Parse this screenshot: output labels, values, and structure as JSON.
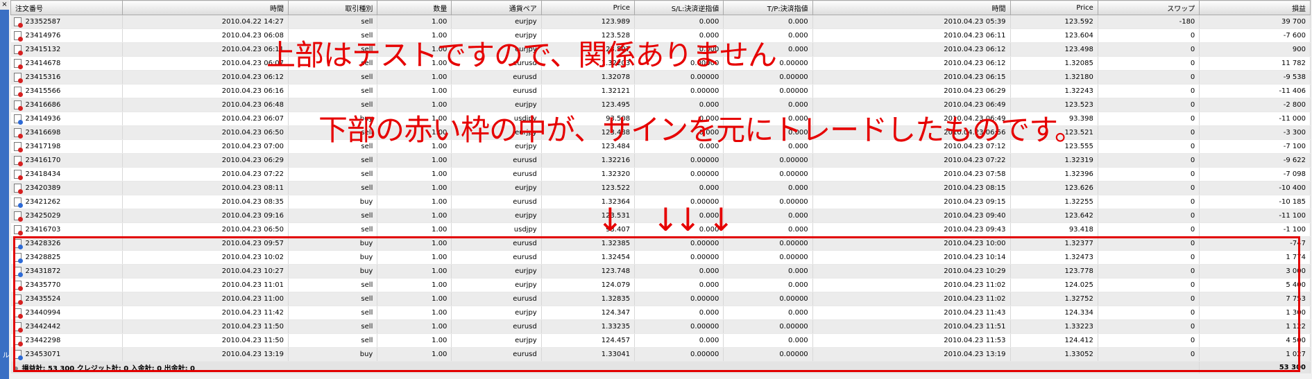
{
  "sidebar": {
    "close_label": "×",
    "vertical_title": "ル"
  },
  "columns": [
    "注文番号",
    "時間",
    "取引種別",
    "数量",
    "通貨ペア",
    "Price",
    "S/L:決済逆指値",
    "T/P:決済指値",
    "時間",
    "Price",
    "スワップ",
    "損益"
  ],
  "rows": [
    {
      "id": "23352587",
      "open_time": "2010.04.22 14:27",
      "type": "sell",
      "lots": "1.00",
      "symbol": "eurjpy",
      "open_price": "123.989",
      "sl": "0.000",
      "tp": "0.000",
      "close_time": "2010.04.23 05:39",
      "close_price": "123.592",
      "swap": "-180",
      "profit": "39 700"
    },
    {
      "id": "23414976",
      "open_time": "2010.04.23 06:08",
      "type": "sell",
      "lots": "1.00",
      "symbol": "eurjpy",
      "open_price": "123.528",
      "sl": "0.000",
      "tp": "0.000",
      "close_time": "2010.04.23 06:11",
      "close_price": "123.604",
      "swap": "0",
      "profit": "-7 600"
    },
    {
      "id": "23415132",
      "open_time": "2010.04.23 06:11",
      "type": "sell",
      "lots": "1.00",
      "symbol": "eurjpy",
      "open_price": "123.507",
      "sl": "0.000",
      "tp": "0.000",
      "close_time": "2010.04.23 06:12",
      "close_price": "123.498",
      "swap": "0",
      "profit": "900"
    },
    {
      "id": "23414678",
      "open_time": "2010.04.23 06:07",
      "type": "sell",
      "lots": "1.00",
      "symbol": "eurusd",
      "open_price": "1.32203",
      "sl": "0.00000",
      "tp": "0.00000",
      "close_time": "2010.04.23 06:12",
      "close_price": "1.32085",
      "swap": "0",
      "profit": "11 782"
    },
    {
      "id": "23415316",
      "open_time": "2010.04.23 06:12",
      "type": "sell",
      "lots": "1.00",
      "symbol": "eurusd",
      "open_price": "1.32078",
      "sl": "0.00000",
      "tp": "0.00000",
      "close_time": "2010.04.23 06:15",
      "close_price": "1.32180",
      "swap": "0",
      "profit": "-9 538"
    },
    {
      "id": "23415566",
      "open_time": "2010.04.23 06:16",
      "type": "sell",
      "lots": "1.00",
      "symbol": "eurusd",
      "open_price": "1.32121",
      "sl": "0.00000",
      "tp": "0.00000",
      "close_time": "2010.04.23 06:29",
      "close_price": "1.32243",
      "swap": "0",
      "profit": "-11 406"
    },
    {
      "id": "23416686",
      "open_time": "2010.04.23 06:48",
      "type": "sell",
      "lots": "1.00",
      "symbol": "eurjpy",
      "open_price": "123.495",
      "sl": "0.000",
      "tp": "0.000",
      "close_time": "2010.04.23 06:49",
      "close_price": "123.523",
      "swap": "0",
      "profit": "-2 800"
    },
    {
      "id": "23414936",
      "open_time": "2010.04.23 06:07",
      "type": "buy",
      "lots": "1.00",
      "symbol": "usdjpy",
      "open_price": "93.508",
      "sl": "0.000",
      "tp": "0.000",
      "close_time": "2010.04.23 06:49",
      "close_price": "93.398",
      "swap": "0",
      "profit": "-11 000"
    },
    {
      "id": "23416698",
      "open_time": "2010.04.23 06:50",
      "type": "sell",
      "lots": "1.00",
      "symbol": "eurjpy",
      "open_price": "123.488",
      "sl": "0.000",
      "tp": "0.000",
      "close_time": "2010.04.23 06:56",
      "close_price": "123.521",
      "swap": "0",
      "profit": "-3 300"
    },
    {
      "id": "23417198",
      "open_time": "2010.04.23 07:00",
      "type": "sell",
      "lots": "1.00",
      "symbol": "eurjpy",
      "open_price": "123.484",
      "sl": "0.000",
      "tp": "0.000",
      "close_time": "2010.04.23 07:12",
      "close_price": "123.555",
      "swap": "0",
      "profit": "-7 100"
    },
    {
      "id": "23416170",
      "open_time": "2010.04.23 06:29",
      "type": "sell",
      "lots": "1.00",
      "symbol": "eurusd",
      "open_price": "1.32216",
      "sl": "0.00000",
      "tp": "0.00000",
      "close_time": "2010.04.23 07:22",
      "close_price": "1.32319",
      "swap": "0",
      "profit": "-9 622"
    },
    {
      "id": "23418434",
      "open_time": "2010.04.23 07:22",
      "type": "sell",
      "lots": "1.00",
      "symbol": "eurusd",
      "open_price": "1.32320",
      "sl": "0.00000",
      "tp": "0.00000",
      "close_time": "2010.04.23 07:58",
      "close_price": "1.32396",
      "swap": "0",
      "profit": "-7 098"
    },
    {
      "id": "23420389",
      "open_time": "2010.04.23 08:11",
      "type": "sell",
      "lots": "1.00",
      "symbol": "eurjpy",
      "open_price": "123.522",
      "sl": "0.000",
      "tp": "0.000",
      "close_time": "2010.04.23 08:15",
      "close_price": "123.626",
      "swap": "0",
      "profit": "-10 400"
    },
    {
      "id": "23421262",
      "open_time": "2010.04.23 08:35",
      "type": "buy",
      "lots": "1.00",
      "symbol": "eurusd",
      "open_price": "1.32364",
      "sl": "0.00000",
      "tp": "0.00000",
      "close_time": "2010.04.23 09:15",
      "close_price": "1.32255",
      "swap": "0",
      "profit": "-10 185"
    },
    {
      "id": "23425029",
      "open_time": "2010.04.23 09:16",
      "type": "sell",
      "lots": "1.00",
      "symbol": "eurjpy",
      "open_price": "123.531",
      "sl": "0.000",
      "tp": "0.000",
      "close_time": "2010.04.23 09:40",
      "close_price": "123.642",
      "swap": "0",
      "profit": "-11 100"
    },
    {
      "id": "23416703",
      "open_time": "2010.04.23 06:50",
      "type": "sell",
      "lots": "1.00",
      "symbol": "usdjpy",
      "open_price": "93.407",
      "sl": "0.000",
      "tp": "0.000",
      "close_time": "2010.04.23 09:43",
      "close_price": "93.418",
      "swap": "0",
      "profit": "-1 100"
    },
    {
      "id": "23428326",
      "open_time": "2010.04.23 09:57",
      "type": "buy",
      "lots": "1.00",
      "symbol": "eurusd",
      "open_price": "1.32385",
      "sl": "0.00000",
      "tp": "0.00000",
      "close_time": "2010.04.23 10:00",
      "close_price": "1.32377",
      "swap": "0",
      "profit": "-747"
    },
    {
      "id": "23428825",
      "open_time": "2010.04.23 10:02",
      "type": "buy",
      "lots": "1.00",
      "symbol": "eurusd",
      "open_price": "1.32454",
      "sl": "0.00000",
      "tp": "0.00000",
      "close_time": "2010.04.23 10:14",
      "close_price": "1.32473",
      "swap": "0",
      "profit": "1 774"
    },
    {
      "id": "23431872",
      "open_time": "2010.04.23 10:27",
      "type": "buy",
      "lots": "1.00",
      "symbol": "eurjpy",
      "open_price": "123.748",
      "sl": "0.000",
      "tp": "0.000",
      "close_time": "2010.04.23 10:29",
      "close_price": "123.778",
      "swap": "0",
      "profit": "3 000"
    },
    {
      "id": "23435770",
      "open_time": "2010.04.23 11:01",
      "type": "sell",
      "lots": "1.00",
      "symbol": "eurjpy",
      "open_price": "124.079",
      "sl": "0.000",
      "tp": "0.000",
      "close_time": "2010.04.23 11:02",
      "close_price": "124.025",
      "swap": "0",
      "profit": "5 400"
    },
    {
      "id": "23435524",
      "open_time": "2010.04.23 11:00",
      "type": "sell",
      "lots": "1.00",
      "symbol": "eurusd",
      "open_price": "1.32835",
      "sl": "0.00000",
      "tp": "0.00000",
      "close_time": "2010.04.23 11:02",
      "close_price": "1.32752",
      "swap": "0",
      "profit": "7 753"
    },
    {
      "id": "23440994",
      "open_time": "2010.04.23 11:42",
      "type": "sell",
      "lots": "1.00",
      "symbol": "eurjpy",
      "open_price": "124.347",
      "sl": "0.000",
      "tp": "0.000",
      "close_time": "2010.04.23 11:43",
      "close_price": "124.334",
      "swap": "0",
      "profit": "1 300"
    },
    {
      "id": "23442442",
      "open_time": "2010.04.23 11:50",
      "type": "sell",
      "lots": "1.00",
      "symbol": "eurusd",
      "open_price": "1.33235",
      "sl": "0.00000",
      "tp": "0.00000",
      "close_time": "2010.04.23 11:51",
      "close_price": "1.33223",
      "swap": "0",
      "profit": "1 122"
    },
    {
      "id": "23442298",
      "open_time": "2010.04.23 11:50",
      "type": "sell",
      "lots": "1.00",
      "symbol": "eurjpy",
      "open_price": "124.457",
      "sl": "0.000",
      "tp": "0.000",
      "close_time": "2010.04.23 11:53",
      "close_price": "124.412",
      "swap": "0",
      "profit": "4 500"
    },
    {
      "id": "23453071",
      "open_time": "2010.04.23 13:19",
      "type": "buy",
      "lots": "1.00",
      "symbol": "eurusd",
      "open_price": "1.33041",
      "sl": "0.00000",
      "tp": "0.00000",
      "close_time": "2010.04.23 13:19",
      "close_price": "1.33052",
      "swap": "0",
      "profit": "1 027"
    }
  ],
  "summary": {
    "left": "損益計:  53 300  クレジット計: 0  入金計: 0  出金計: 0",
    "right": "53 300"
  },
  "annotations": {
    "line1": "上部はテストですので、関係ありません",
    "line2": "下部の赤い枠の中が、サインを元にトレードしたものです。",
    "arrows": "↓"
  }
}
